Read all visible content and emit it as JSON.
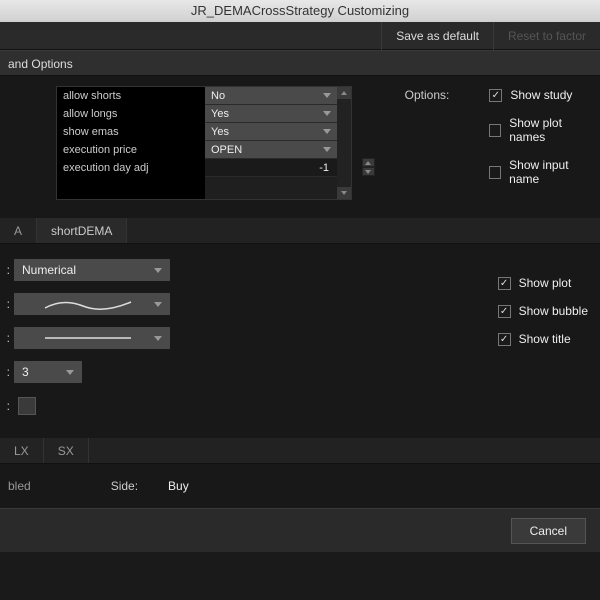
{
  "window": {
    "title": "JR_DEMACrossStrategy Customizing"
  },
  "topbar": {
    "save_default": "Save as default",
    "reset_factory": "Reset to factor"
  },
  "section1": {
    "header": "and Options",
    "inputs": [
      {
        "name": "allow shorts",
        "value": "No",
        "type": "select"
      },
      {
        "name": "allow longs",
        "value": "Yes",
        "type": "select"
      },
      {
        "name": "show emas",
        "value": "Yes",
        "type": "select"
      },
      {
        "name": "execution price",
        "value": "OPEN",
        "type": "select"
      },
      {
        "name": "execution day adj",
        "value": "-1",
        "type": "number"
      }
    ],
    "options_label": "Options:",
    "options": [
      {
        "label": "Show study",
        "checked": true
      },
      {
        "label": "Show plot names",
        "checked": false
      },
      {
        "label": "Show input name",
        "checked": false
      }
    ]
  },
  "plots": {
    "tabs": [
      "A",
      "shortDEMA"
    ],
    "active_tab": 1,
    "rows": {
      "draw_as": {
        "label": ":",
        "value": "Numerical"
      },
      "style": {
        "label": ":"
      },
      "line": {
        "label": ":"
      },
      "width": {
        "label": ":",
        "value": "3"
      },
      "color": {
        "label": ":"
      }
    },
    "options": [
      {
        "label": "Show plot",
        "checked": true
      },
      {
        "label": "Show bubble",
        "checked": true
      },
      {
        "label": "Show title",
        "checked": true
      }
    ]
  },
  "orders": {
    "tabs": [
      "LX",
      "SX"
    ],
    "enabled_label": "bled",
    "side_label": "Side:",
    "side_value": "Buy"
  },
  "footer": {
    "cancel": "Cancel"
  }
}
